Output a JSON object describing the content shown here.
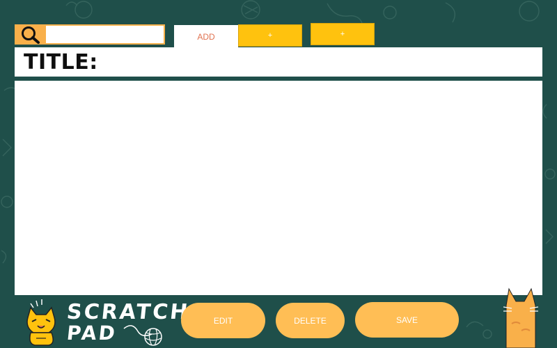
{
  "search": {
    "value": "",
    "placeholder": ""
  },
  "tabs": [
    {
      "label": "ADD"
    },
    {
      "label": "+"
    },
    {
      "label": "+"
    }
  ],
  "note": {
    "title_label": "TITLE:",
    "body": ""
  },
  "actions": {
    "edit_label": "EDIT",
    "delete_label": "DELETE",
    "save_label": "SAVE"
  },
  "logo": {
    "line1": "SCRATCH",
    "line2": "PAD"
  },
  "colors": {
    "background": "#1f4f4a",
    "accent_orange": "#ffbe55",
    "accent_yellow": "#ffc20e",
    "search_box": "#f9b04a",
    "tab_text": "#e0714f"
  }
}
